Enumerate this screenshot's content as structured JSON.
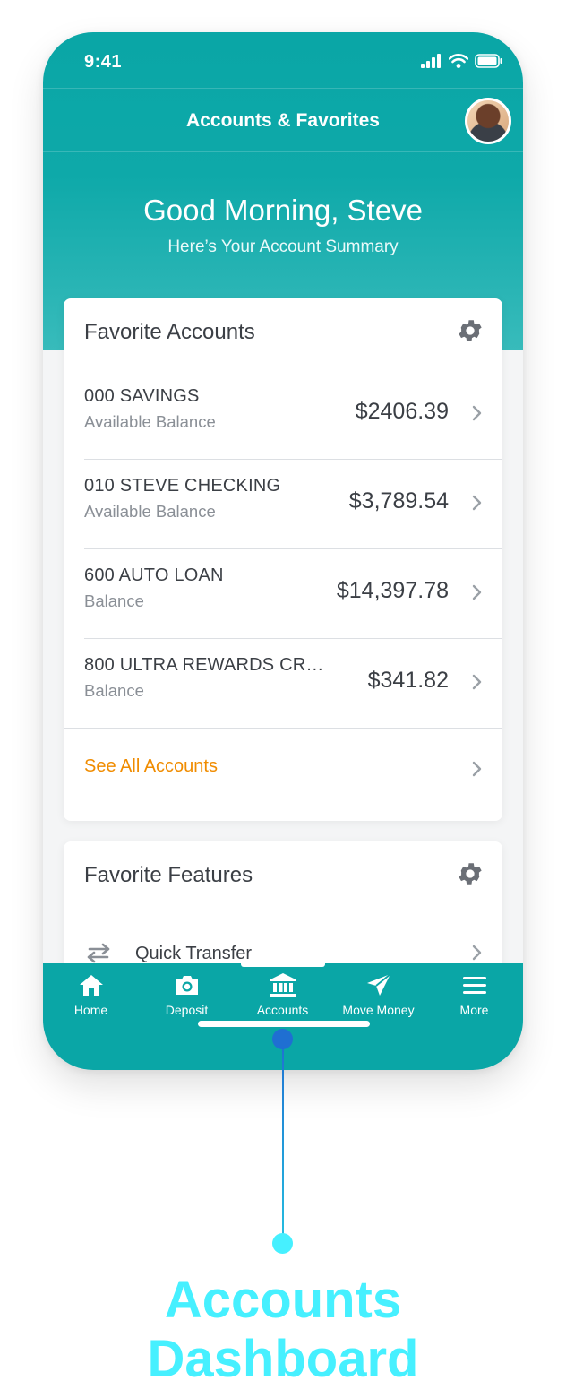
{
  "status_bar": {
    "time": "9:41"
  },
  "header": {
    "title": "Accounts & Favorites"
  },
  "greeting": {
    "title": "Good Morning, Steve",
    "subtitle": "Here’s Your Account Summary"
  },
  "favorite_accounts": {
    "title": "Favorite Accounts",
    "accounts": [
      {
        "name": "000 SAVINGS",
        "label": "Available Balance",
        "amount": "$2406.39"
      },
      {
        "name": "010 STEVE CHECKING",
        "label": "Available Balance",
        "amount": "$3,789.54"
      },
      {
        "name": "600 AUTO LOAN",
        "label": "Balance",
        "amount": "$14,397.78"
      },
      {
        "name": "800 ULTRA REWARDS CR…",
        "label": "Balance",
        "amount": "$341.82"
      }
    ],
    "see_all_label": "See All Accounts"
  },
  "favorite_features": {
    "title": "Favorite Features",
    "items": [
      {
        "label": "Quick Transfer"
      }
    ]
  },
  "tab_bar": {
    "items": [
      {
        "label": "Home",
        "icon": "home-icon"
      },
      {
        "label": "Deposit",
        "icon": "camera-icon"
      },
      {
        "label": "Accounts",
        "icon": "bank-icon"
      },
      {
        "label": "Move Money",
        "icon": "paper-plane-icon"
      },
      {
        "label": "More",
        "icon": "menu-icon"
      }
    ],
    "selected": "Accounts"
  },
  "callout": {
    "line1": "Accounts",
    "line2": "Dashboard"
  },
  "colors": {
    "teal": "#0aa6a6",
    "orange_link": "#f08c00",
    "callout_cyan": "#46f0ff",
    "callout_blue": "#1f6fd2"
  }
}
